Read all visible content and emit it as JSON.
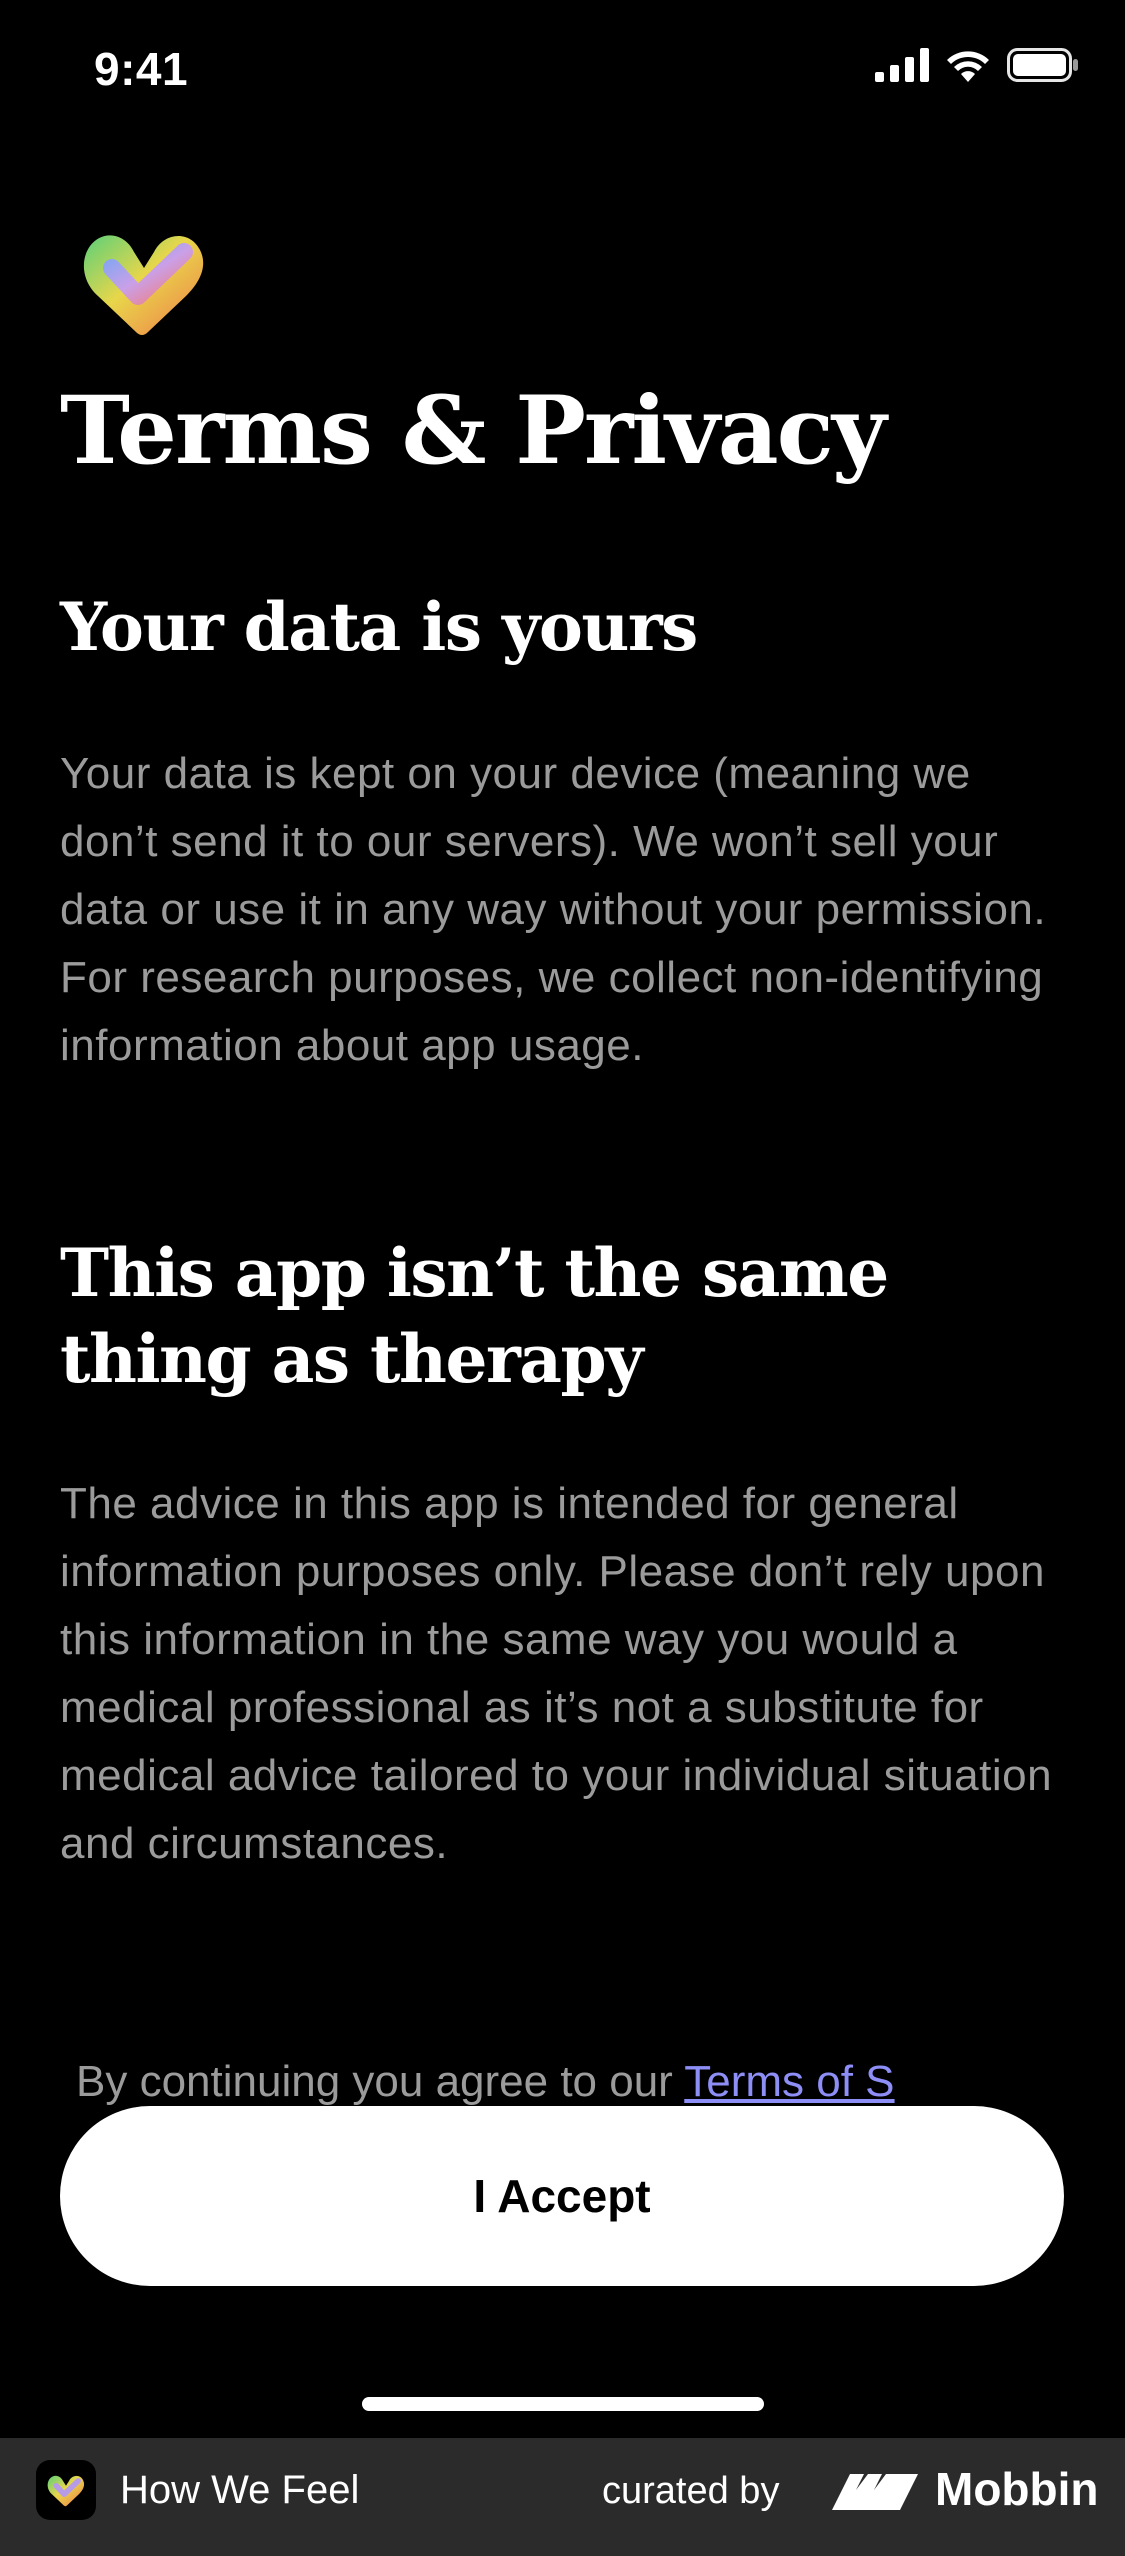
{
  "status_bar": {
    "time": "9:41"
  },
  "icons": {
    "logo": "heart-logo-icon",
    "signal": "cellular-signal-icon",
    "wifi": "wifi-icon",
    "battery": "battery-icon",
    "footer_app": "how-we-feel-app-icon",
    "mobbin": "mobbin-logo-icon"
  },
  "page": {
    "title": "Terms & Privacy"
  },
  "sections": [
    {
      "heading": "Your data is yours",
      "body": "Your data is kept on your device (meaning we don’t send it to our servers). We won’t sell your data or use it in any way without your permission. For research purposes, we collect non-identifying information about app usage."
    },
    {
      "heading": "This app isn’t the same thing as therapy",
      "body": "The advice in this app is intended for general information purposes only. Please don’t rely upon this information in the same way you would a medical professional as it’s not a substitute for medical advice tailored to your individual situation and circumstances."
    }
  ],
  "agreement": {
    "prefix": "By continuing you agree to our ",
    "link_text": "Terms of S"
  },
  "accept_button": {
    "label": "I Accept"
  },
  "footer": {
    "app_name": "How We Feel",
    "curated_by": "curated by",
    "brand": "Mobbin"
  },
  "colors": {
    "background": "#000000",
    "body_text": "#9b9b9b",
    "link": "#8e8ef7",
    "button_bg": "#ffffff",
    "footer_bg": "#2b2b2b"
  }
}
